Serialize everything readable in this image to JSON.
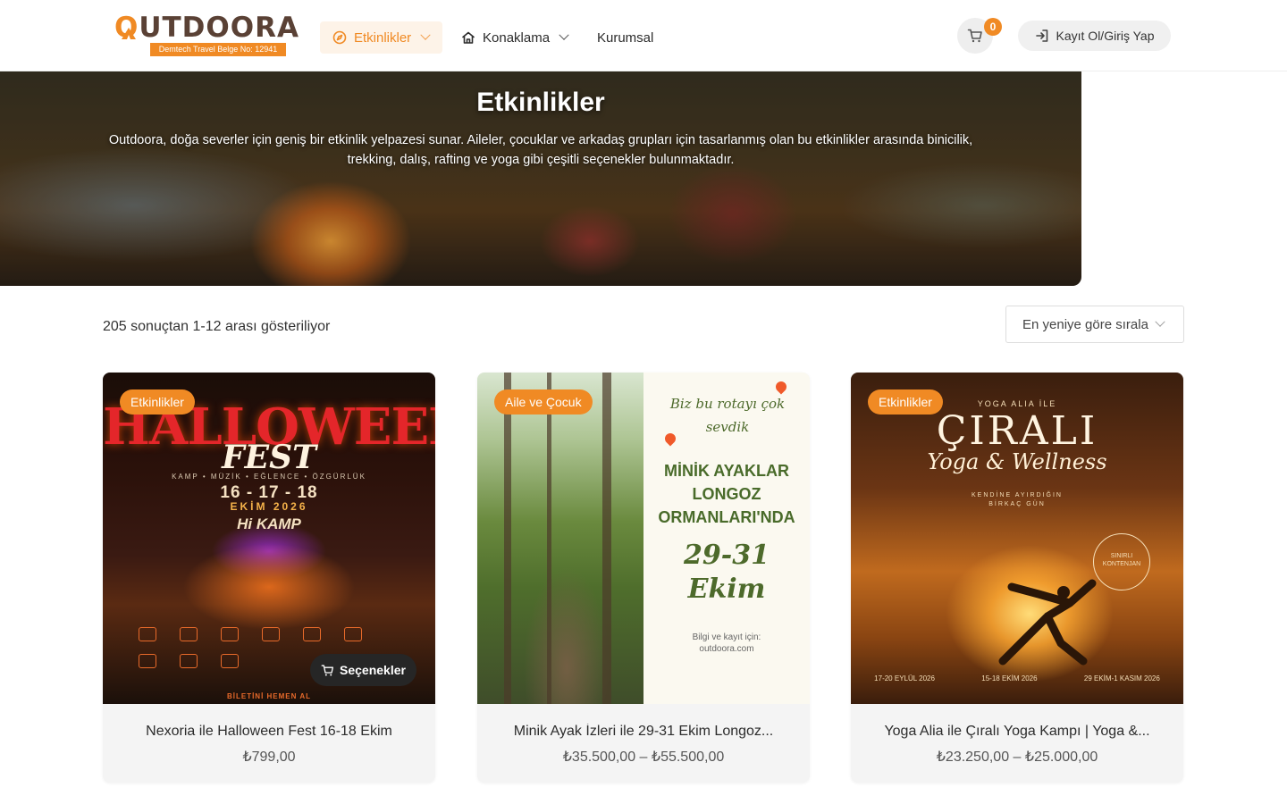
{
  "brand": {
    "logo_text_1": "",
    "logo_text_o": "O",
    "logo_text_2": "UTDOORA",
    "logo_sub": "Demtech Travel Belge No: 12941"
  },
  "nav": {
    "events": "Etkinlikler",
    "lodging": "Konaklama",
    "corporate": "Kurumsal"
  },
  "header": {
    "cart_count": "0",
    "login_label": "Kayıt Ol/Giriş Yap"
  },
  "hero": {
    "title": "Etkinlikler",
    "description": "Outdoora, doğa severler için geniş bir etkinlik yelpazesi sunar. Aileler, çocuklar ve arkadaş grupları için tasarlanmış olan bu etkinlikler arasında binicilik, trekking, dalış, rafting ve yoga gibi çeşitli seçenekler bulunmaktadır."
  },
  "results": {
    "count_text": "205 sonuçtan 1-12 arası gösteriliyor",
    "sort_label": "En yeniye göre sırala"
  },
  "products": [
    {
      "category": "Etkinlikler",
      "title": "Nexoria ile Halloween Fest 16-18 Ekim",
      "price": "₺799,00",
      "options_label": "Seçenekler",
      "art": {
        "headline": "HALLOWEEN",
        "fest": "FEST",
        "tagline": "KAMP • MÜZİK • EĞLENCE • ÖZGÜRLÜK",
        "dates": "16 - 17 - 18",
        "month": "EKİM 2026",
        "place": "Hi KAMP",
        "bottom": "BİLETİNİ HEMEN AL"
      }
    },
    {
      "category": "Aile ve Çocuk",
      "title": "Minik Ayak İzleri ile 29-31 Ekim Longoz...",
      "price": "₺35.500,00 – ₺55.500,00",
      "art": {
        "script": "Biz bu rotayı çok sevdik",
        "headline_1": "MİNİK AYAKLAR",
        "headline_2": "LONGOZ",
        "headline_3": "ORMANLARI'NDA",
        "dates": "29-31",
        "month": "Ekim",
        "info_1": "Bilgi ve kayıt için:",
        "info_2": "outdoora.com"
      }
    },
    {
      "category": "Etkinlikler",
      "title": "Yoga Alia ile Çıralı Yoga Kampı | Yoga &...",
      "price": "₺23.250,00 – ₺25.000,00",
      "art": {
        "small": "YOGA ALIA İLE",
        "headline": "ÇIRALI",
        "script": "Yoga & Wellness",
        "sub_1": "KENDİNE AYIRDIĞIN",
        "sub_2": "BİRKAÇ GÜN",
        "seal": "SINIRLI KONTENJAN",
        "date_1": "17-20 EYLÜL 2026",
        "date_2": "15-18 EKİM 2026",
        "date_3": "29 EKİM-1 KASIM 2026"
      }
    }
  ],
  "colors": {
    "accent": "#f08a24",
    "brand_brown": "#5a4135"
  }
}
